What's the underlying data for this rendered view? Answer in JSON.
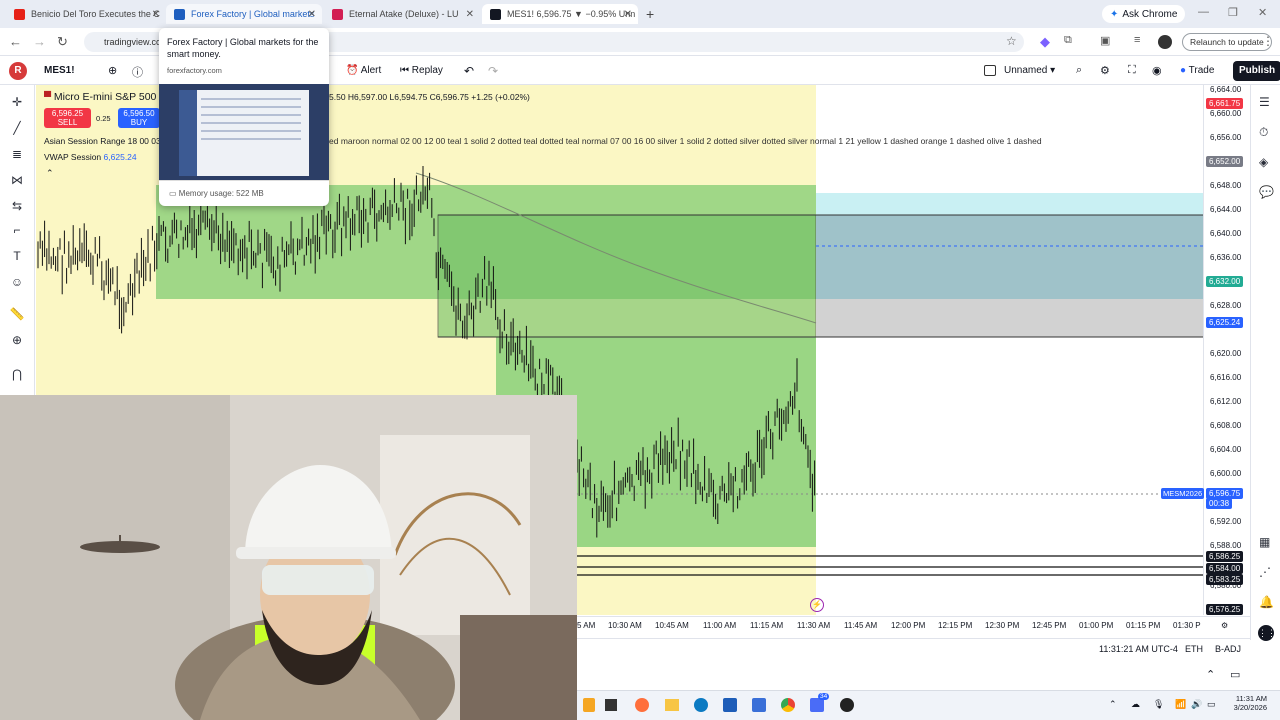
{
  "tabs": [
    {
      "title": "Benicio Del Toro Executes the C",
      "icon": "youtube-icon",
      "color": "#e62117"
    },
    {
      "title": "Forex Factory | Global markets",
      "icon": "forexfactory-icon",
      "color": "#1f5fbf"
    },
    {
      "title": "Eternal Atake (Deluxe) - LU",
      "icon": "music-icon",
      "color": "#d21e53"
    },
    {
      "title": "MES1! 6,596.75 ▼ −0.95% Unn",
      "icon": "tradingview-icon",
      "color": "#131722"
    }
  ],
  "ask_chrome": "Ask Chrome",
  "address": "tradingview.co",
  "relaunch": "Relaunch to update",
  "hover_card": {
    "title": "Forex Factory | Global markets for the smart money.",
    "domain": "forexfactory.com",
    "memory": "Memory usage: 522 MB"
  },
  "toolbar": {
    "symbol": "MES1!",
    "alert": "Alert",
    "replay": "Replay",
    "layout": "Unnamed",
    "trade": "Trade",
    "publish": "Publish"
  },
  "legend": {
    "title": "Micro E-mini S&P 500",
    "ohlc": "5.50 H6,597.00 L6,594.75 C6,596.75 +1.25 (+0.02%)",
    "sell_price": "6,596.25",
    "sell_label": "SELL",
    "spread": "0.25",
    "buy_price": "6,596.50",
    "buy_label": "BUY",
    "indicator1": "Asian Session Range 18 00 03",
    "indicator1_params": "ed maroon normal 02 00 12 00 teal 1 solid 2 dotted teal dotted teal normal 07 00 16 00 silver 1 solid 2 dotted silver dotted silver normal 1 21 yellow 1 dashed orange 1 dashed olive 1 dashed",
    "indicator2": "VWAP Session",
    "indicator2_value": "6,625.24"
  },
  "price_axis": {
    "labels": [
      "6,664.00",
      "6,660.00",
      "6,656.00",
      "6,648.00",
      "6,644.00",
      "6,640.00",
      "6,636.00",
      "6,628.00",
      "6,620.00",
      "6,616.00",
      "6,612.00",
      "6,608.00",
      "6,604.00",
      "6,600.00",
      "6,592.00",
      "6,588.00",
      "6,580.00"
    ],
    "tags": [
      {
        "value": "6,661.75",
        "color": "#f23645"
      },
      {
        "value": "6,652.00",
        "color": "#787b86"
      },
      {
        "value": "6,632.00",
        "color": "#22ab94"
      },
      {
        "value": "6,625.24",
        "color": "#2962ff"
      },
      {
        "value": "6,596.75",
        "color": "#2962ff"
      },
      {
        "value": "00:38",
        "color": "#2962ff"
      },
      {
        "value": "6,586.25",
        "color": "#131722"
      },
      {
        "value": "6,584.00",
        "color": "#131722"
      },
      {
        "value": "6,583.25",
        "color": "#131722"
      },
      {
        "value": "6,576.25",
        "color": "#131722"
      }
    ],
    "contract": "MESM2026"
  },
  "time_axis": [
    "5 AM",
    "10:30 AM",
    "10:45 AM",
    "11:00 AM",
    "11:15 AM",
    "11:30 AM",
    "11:45 AM",
    "12:00 PM",
    "12:15 PM",
    "12:30 PM",
    "12:45 PM",
    "01:00 PM",
    "01:15 PM",
    "01:30 P"
  ],
  "status": {
    "clock": "11:31:21 AM UTC-4",
    "session": "ETH",
    "adj": "B-ADJ"
  },
  "taskbar": {
    "time": "11:31 AM",
    "date": "3/20/2026",
    "badge": "34"
  }
}
